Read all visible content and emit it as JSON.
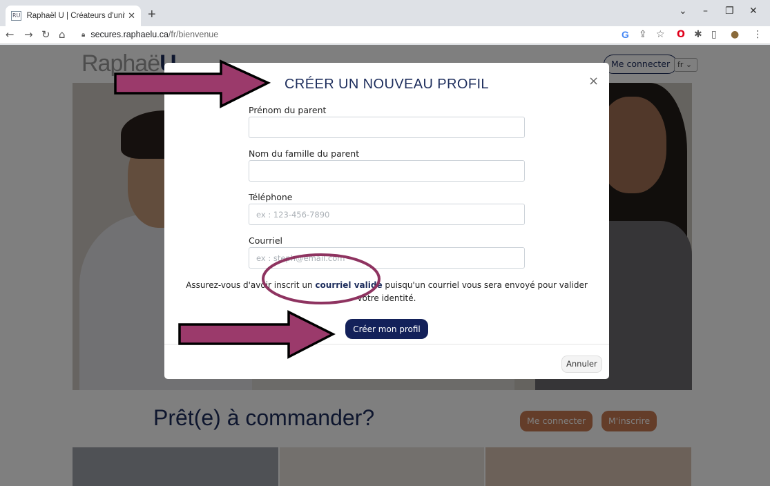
{
  "browser": {
    "tab_title": "Raphaël U | Créateurs d'uniforme",
    "favicon_text": "RU",
    "url_domain": "secures.raphaelu.ca",
    "url_path": "/fr/bienvenue"
  },
  "site": {
    "logo_light": "Raphaë",
    "logo_bold": "U",
    "login_label": "Me connecter",
    "lang": "fr",
    "ready_title": "Prêt(e) à commander?",
    "ready_login": "Me connecter",
    "ready_signup": "M'inscrire"
  },
  "modal": {
    "title": "CRÉER UN NOUVEAU PROFIL",
    "fields": [
      {
        "label": "Prénom du parent",
        "placeholder": ""
      },
      {
        "label": "Nom du famille du parent",
        "placeholder": ""
      },
      {
        "label": "Téléphone",
        "placeholder": "ex : 123-456-7890"
      },
      {
        "label": "Courriel",
        "placeholder": "ex : steph@email.com"
      }
    ],
    "notice_before": "Assurez-vous d'avoir inscrit un ",
    "notice_bold": "courriel valide",
    "notice_after": " puisqu'un courriel vous sera envoyé pour valider votre identité.",
    "submit_label": "Créer mon profil",
    "cancel_label": "Annuler"
  },
  "colors": {
    "brand_navy": "#1d2d5c",
    "submit_bg": "#13215a",
    "annotation_arrow": "#9b3a6b",
    "ready_button": "#c97a52"
  }
}
